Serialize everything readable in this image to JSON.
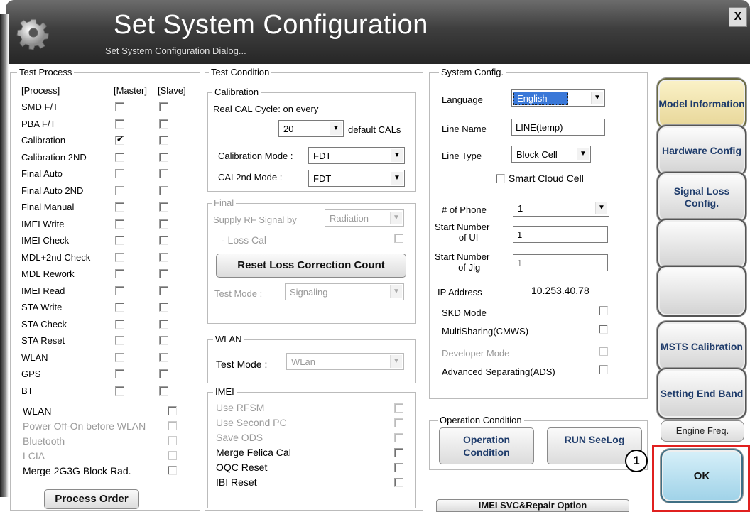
{
  "window": {
    "title": "Set System Configuration",
    "subtitle": "Set System Configuration Dialog...",
    "close_label": "X"
  },
  "test_process": {
    "legend": "Test Process",
    "col_process": "[Process]",
    "col_master": "[Master]",
    "col_slave": "[Slave]",
    "rows": [
      {
        "label": "SMD F/T",
        "master": false,
        "slave": false
      },
      {
        "label": "PBA F/T",
        "master": false,
        "slave": false
      },
      {
        "label": "Calibration",
        "master": true,
        "slave": false
      },
      {
        "label": "Calibration 2ND",
        "master": false,
        "slave": false
      },
      {
        "label": "Final Auto",
        "master": false,
        "slave": false
      },
      {
        "label": "Final Auto 2ND",
        "master": false,
        "slave": false
      },
      {
        "label": "Final Manual",
        "master": false,
        "slave": false
      },
      {
        "label": "IMEI Write",
        "master": false,
        "slave": false
      },
      {
        "label": "IMEI Check",
        "master": false,
        "slave": false
      },
      {
        "label": "MDL+2nd Check",
        "master": false,
        "slave": false
      },
      {
        "label": "MDL Rework",
        "master": false,
        "slave": false
      },
      {
        "label": "IMEI Read",
        "master": false,
        "slave": false
      },
      {
        "label": "STA Write",
        "master": false,
        "slave": false
      },
      {
        "label": "STA Check",
        "master": false,
        "slave": false
      },
      {
        "label": "STA Reset",
        "master": false,
        "slave": false
      },
      {
        "label": "WLAN",
        "master": false,
        "slave": false
      },
      {
        "label": "GPS",
        "master": false,
        "slave": false
      },
      {
        "label": "BT",
        "master": false,
        "slave": false
      }
    ],
    "options": [
      {
        "label": "WLAN",
        "disabled": false
      },
      {
        "label": "Power Off-On before WLAN",
        "disabled": true
      },
      {
        "label": "Bluetooth",
        "disabled": true
      },
      {
        "label": "LCIA",
        "disabled": true
      },
      {
        "label": "Merge 2G3G Block Rad.",
        "disabled": false
      }
    ],
    "process_order_button": "Process Order"
  },
  "test_condition": {
    "legend": "Test Condition",
    "calibration": {
      "legend": "Calibration",
      "cycle_label": "Real CAL Cycle: on every",
      "cycle_value": "20",
      "cycle_suffix": "default CALs",
      "mode_label": "Calibration Mode :",
      "mode_value": "FDT",
      "cal2nd_label": "CAL2nd Mode :",
      "cal2nd_value": "FDT"
    },
    "final": {
      "legend": "Final",
      "supply_label": "Supply RF Signal by",
      "supply_value": "Radiation",
      "loss_cal_label": "- Loss Cal",
      "reset_button": "Reset Loss Correction Count",
      "test_mode_label": "Test Mode :",
      "test_mode_value": "Signaling"
    },
    "wlan": {
      "legend": "WLAN",
      "test_mode_label": "Test Mode :",
      "test_mode_value": "WLan"
    },
    "imei": {
      "legend": "IMEI",
      "items": [
        {
          "label": "Use RFSM",
          "disabled": true
        },
        {
          "label": "Use Second PC",
          "disabled": true
        },
        {
          "label": "Save ODS",
          "disabled": true
        },
        {
          "label": "Merge Felica Cal",
          "disabled": false
        },
        {
          "label": "OQC Reset",
          "disabled": false
        },
        {
          "label": "IBI Reset",
          "disabled": false
        }
      ]
    }
  },
  "system_config": {
    "legend": "System Config.",
    "language_label": "Language",
    "language_value": "English",
    "line_name_label": "Line Name",
    "line_name_value": "LINE(temp)",
    "line_type_label": "Line Type",
    "line_type_value": "Block Cell",
    "smart_cloud_label": "Smart Cloud Cell",
    "num_phone_label": "# of Phone",
    "num_phone_value": "1",
    "start_ui_label_1": "Start Number",
    "start_ui_label_2": "of UI",
    "start_ui_value": "1",
    "start_jig_label_1": "Start Number",
    "start_jig_label_2": "of Jig",
    "start_jig_value": "1",
    "ip_label": "IP Address",
    "ip_value": "10.253.40.78",
    "options": [
      {
        "label": "SKD Mode",
        "disabled": false
      },
      {
        "label": "MultiSharing(CMWS)",
        "disabled": false
      },
      {
        "label": "Developer Mode",
        "disabled": true
      },
      {
        "label": "Advanced Separating(ADS)",
        "disabled": false
      }
    ]
  },
  "operation_condition": {
    "legend": "Operation Condition",
    "op_button": "Operation Condition",
    "run_button": "RUN SeeLog"
  },
  "imei_svc_button": "IMEI SVC&Repair Option",
  "sidebar": {
    "model_info": "Model Information",
    "hardware_config": "Hardware Config",
    "signal_loss": "Signal Loss Config.",
    "msts_cal": "MSTS Calibration",
    "setting_end_band": "Setting End Band",
    "engine_freq": "Engine Freq.",
    "ok": "OK"
  },
  "annotation": {
    "step_number": "1",
    "highlight_color": "#e0201f"
  },
  "colors": {
    "accent_blue": "#3a78d8",
    "model_info_bg": "#efe2a8",
    "ok_bg": "#b8dfef"
  }
}
